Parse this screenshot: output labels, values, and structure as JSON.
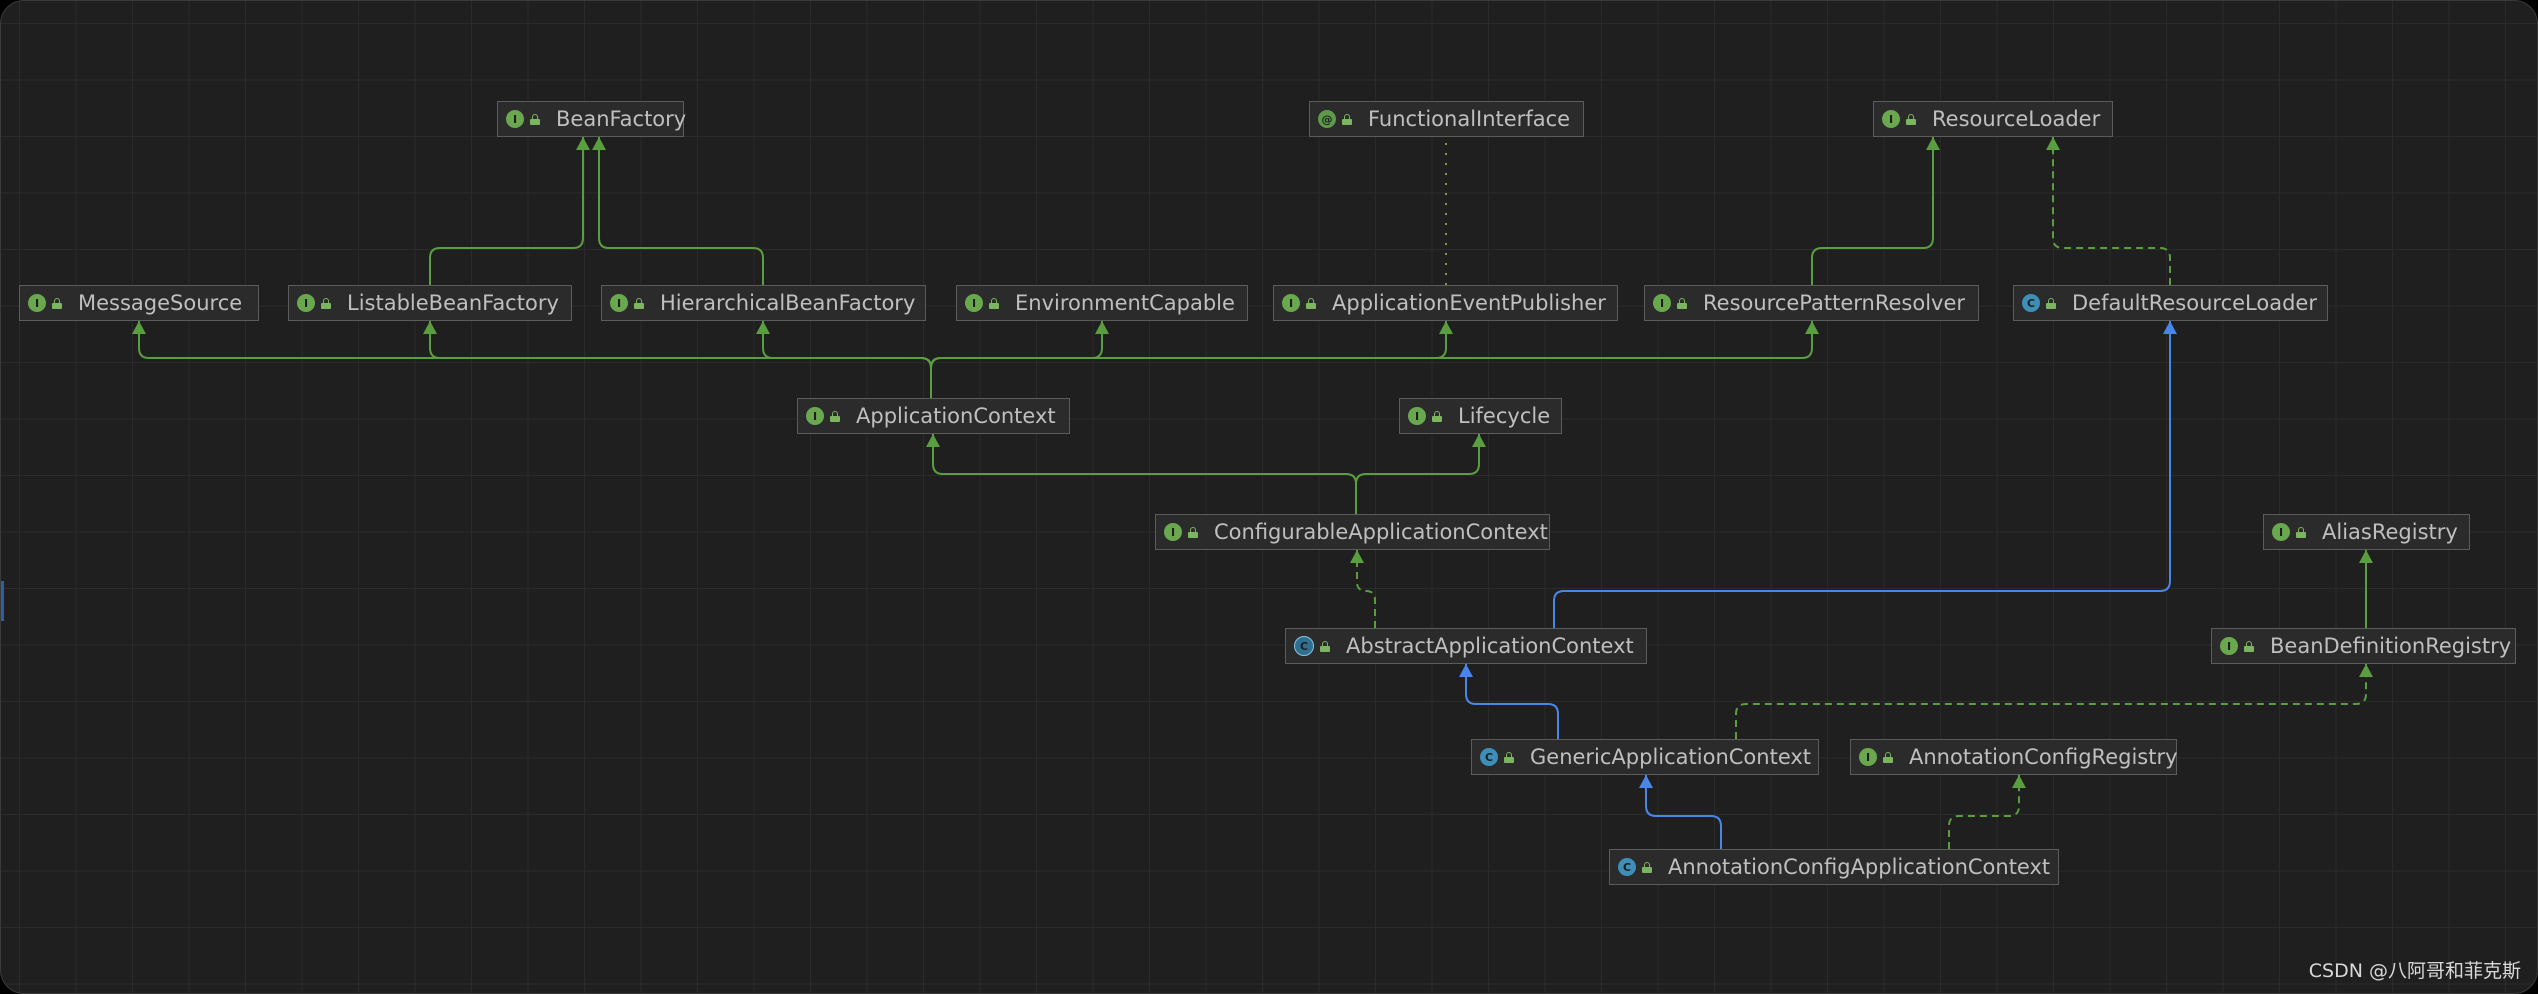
{
  "diagram": {
    "nodes": [
      {
        "id": "BeanFactory",
        "label": "BeanFactory",
        "kind": "interface",
        "badge": "I"
      },
      {
        "id": "FunctionalInterface",
        "label": "FunctionalInterface",
        "kind": "annotation",
        "badge": "@"
      },
      {
        "id": "ResourceLoader",
        "label": "ResourceLoader",
        "kind": "interface",
        "badge": "I"
      },
      {
        "id": "MessageSource",
        "label": "MessageSource",
        "kind": "interface",
        "badge": "I"
      },
      {
        "id": "ListableBeanFactory",
        "label": "ListableBeanFactory",
        "kind": "interface",
        "badge": "I"
      },
      {
        "id": "HierarchicalBeanFactory",
        "label": "HierarchicalBeanFactory",
        "kind": "interface",
        "badge": "I"
      },
      {
        "id": "EnvironmentCapable",
        "label": "EnvironmentCapable",
        "kind": "interface",
        "badge": "I"
      },
      {
        "id": "ApplicationEventPublisher",
        "label": "ApplicationEventPublisher",
        "kind": "interface",
        "badge": "I"
      },
      {
        "id": "ResourcePatternResolver",
        "label": "ResourcePatternResolver",
        "kind": "interface",
        "badge": "I"
      },
      {
        "id": "DefaultResourceLoader",
        "label": "DefaultResourceLoader",
        "kind": "class",
        "badge": "C"
      },
      {
        "id": "ApplicationContext",
        "label": "ApplicationContext",
        "kind": "interface",
        "badge": "I"
      },
      {
        "id": "Lifecycle",
        "label": "Lifecycle",
        "kind": "interface",
        "badge": "I"
      },
      {
        "id": "ConfigurableApplicationContext",
        "label": "ConfigurableApplicationContext",
        "kind": "interface",
        "badge": "I"
      },
      {
        "id": "AliasRegistry",
        "label": "AliasRegistry",
        "kind": "interface",
        "badge": "I"
      },
      {
        "id": "AbstractApplicationContext",
        "label": "AbstractApplicationContext",
        "kind": "abstract",
        "badge": "C"
      },
      {
        "id": "BeanDefinitionRegistry",
        "label": "BeanDefinitionRegistry",
        "kind": "interface",
        "badge": "I"
      },
      {
        "id": "GenericApplicationContext",
        "label": "GenericApplicationContext",
        "kind": "class",
        "badge": "C"
      },
      {
        "id": "AnnotationConfigRegistry",
        "label": "AnnotationConfigRegistry",
        "kind": "interface",
        "badge": "I"
      },
      {
        "id": "AnnotationConfigApplicationContext",
        "label": "AnnotationConfigApplicationContext",
        "kind": "class",
        "badge": "C"
      }
    ],
    "edges": [
      {
        "from": "ListableBeanFactory",
        "to": "BeanFactory",
        "type": "extends-interface"
      },
      {
        "from": "HierarchicalBeanFactory",
        "to": "BeanFactory",
        "type": "extends-interface"
      },
      {
        "from": "ApplicationEventPublisher",
        "to": "FunctionalInterface",
        "type": "annotated"
      },
      {
        "from": "ResourcePatternResolver",
        "to": "ResourceLoader",
        "type": "extends-interface"
      },
      {
        "from": "DefaultResourceLoader",
        "to": "ResourceLoader",
        "type": "implements"
      },
      {
        "from": "ApplicationContext",
        "to": "MessageSource",
        "type": "extends-interface"
      },
      {
        "from": "ApplicationContext",
        "to": "ListableBeanFactory",
        "type": "extends-interface"
      },
      {
        "from": "ApplicationContext",
        "to": "HierarchicalBeanFactory",
        "type": "extends-interface"
      },
      {
        "from": "ApplicationContext",
        "to": "EnvironmentCapable",
        "type": "extends-interface"
      },
      {
        "from": "ApplicationContext",
        "to": "ApplicationEventPublisher",
        "type": "extends-interface"
      },
      {
        "from": "ApplicationContext",
        "to": "ResourcePatternResolver",
        "type": "extends-interface"
      },
      {
        "from": "ConfigurableApplicationContext",
        "to": "ApplicationContext",
        "type": "extends-interface"
      },
      {
        "from": "ConfigurableApplicationContext",
        "to": "Lifecycle",
        "type": "extends-interface"
      },
      {
        "from": "AbstractApplicationContext",
        "to": "ConfigurableApplicationContext",
        "type": "implements"
      },
      {
        "from": "AbstractApplicationContext",
        "to": "DefaultResourceLoader",
        "type": "extends-class"
      },
      {
        "from": "BeanDefinitionRegistry",
        "to": "AliasRegistry",
        "type": "extends-interface"
      },
      {
        "from": "GenericApplicationContext",
        "to": "AbstractApplicationContext",
        "type": "extends-class"
      },
      {
        "from": "GenericApplicationContext",
        "to": "BeanDefinitionRegistry",
        "type": "implements"
      },
      {
        "from": "AnnotationConfigApplicationContext",
        "to": "GenericApplicationContext",
        "type": "extends-class"
      },
      {
        "from": "AnnotationConfigApplicationContext",
        "to": "AnnotationConfigRegistry",
        "type": "implements"
      }
    ]
  },
  "colors": {
    "interface_edge": "#5a9e3f",
    "class_edge": "#4a86e8",
    "annotation_edge": "#8a8f4a"
  },
  "watermark": "CSDN @八阿哥和菲克斯"
}
